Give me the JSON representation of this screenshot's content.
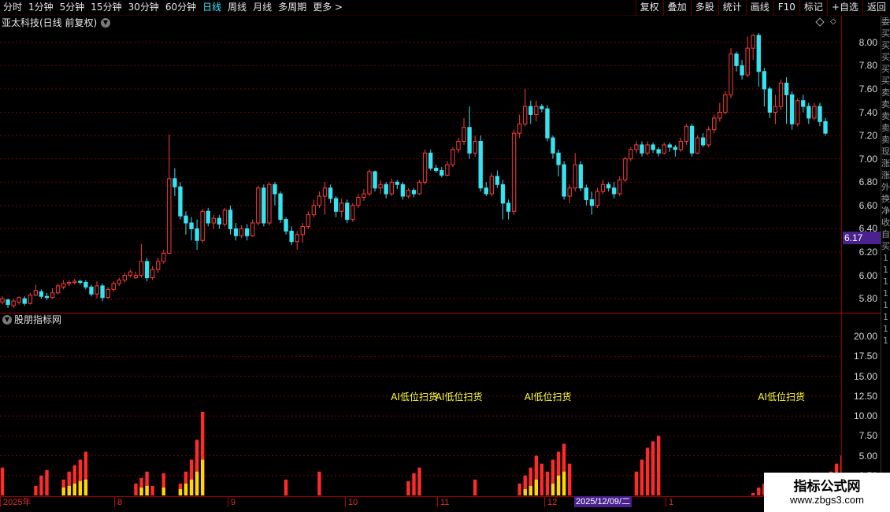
{
  "toolbar": {
    "periods": [
      "分时",
      "1分钟",
      "5分钟",
      "15分钟",
      "30分钟",
      "60分钟",
      "日线",
      "周线",
      "月线",
      "多周期",
      "更多 >"
    ],
    "active_period": "日线",
    "tools": [
      "复权",
      "叠加",
      "多股",
      "统计",
      "画线",
      "F10",
      "标记",
      "+自选",
      "返回"
    ]
  },
  "stock": {
    "title": "亚太科技(日线 前复权)",
    "last_price_label": "6.17"
  },
  "indicator": {
    "title": "股朋指标网",
    "signal_label": "AI低位扫货"
  },
  "side_chars": [
    "委",
    "买",
    "买",
    "买",
    "买",
    "买",
    "卖",
    "卖",
    "卖",
    "卖",
    "卖",
    "现",
    "涨",
    "涨",
    "外",
    "换",
    "净",
    "收",
    "自",
    "买",
    "1",
    "1",
    "1",
    "1",
    "1",
    "1",
    "1",
    "1"
  ],
  "time_axis": {
    "labels": [
      "2025年",
      "8",
      "9",
      "10",
      "11",
      "12",
      "1"
    ],
    "cursor_date": "2025/12/09/二"
  },
  "watermark": {
    "title": "指标公式网",
    "url": "www.zbgs3.com"
  },
  "colors": {
    "up": "#ff3c3c",
    "down": "#36e3f0",
    "grid": "#7a0000",
    "signal": "#ffff33",
    "vol_red": "#ff2a2a",
    "vol_yellow": "#ffd700"
  },
  "chart_data": {
    "type": "candlestick",
    "price_axis": {
      "ticks": [
        "8.00",
        "7.80",
        "7.60",
        "7.40",
        "7.20",
        "7.00",
        "6.80",
        "6.60",
        "6.40",
        "6.20",
        "6.00",
        "5.80"
      ],
      "ylim": [
        5.7,
        8.12
      ]
    },
    "indicator_axis": {
      "ticks": [
        "20.00",
        "17.50",
        "15.00",
        "12.50",
        "10.00",
        "7.50",
        "5.00",
        "2.50"
      ],
      "ylim": [
        0,
        21.5
      ]
    },
    "candles": [
      [
        5.77,
        5.8,
        5.82,
        5.75
      ],
      [
        5.79,
        5.75,
        5.8,
        5.72
      ],
      [
        5.74,
        5.78,
        5.8,
        5.72
      ],
      [
        5.77,
        5.81,
        5.82,
        5.75
      ],
      [
        5.8,
        5.76,
        5.82,
        5.74
      ],
      [
        5.76,
        5.83,
        5.85,
        5.75
      ],
      [
        5.83,
        5.87,
        5.92,
        5.82
      ],
      [
        5.86,
        5.82,
        5.88,
        5.8
      ],
      [
        5.82,
        5.81,
        5.85,
        5.79
      ],
      [
        5.81,
        5.85,
        5.89,
        5.8
      ],
      [
        5.85,
        5.91,
        5.93,
        5.84
      ],
      [
        5.9,
        5.93,
        5.96,
        5.88
      ],
      [
        5.93,
        5.94,
        5.96,
        5.91
      ],
      [
        5.94,
        5.95,
        5.97,
        5.92
      ],
      [
        5.95,
        5.94,
        5.96,
        5.92
      ],
      [
        5.94,
        5.9,
        5.96,
        5.88
      ],
      [
        5.9,
        5.84,
        5.92,
        5.82
      ],
      [
        5.84,
        5.91,
        5.95,
        5.8
      ],
      [
        5.91,
        5.81,
        5.93,
        5.78
      ],
      [
        5.81,
        5.88,
        5.9,
        5.8
      ],
      [
        5.88,
        5.93,
        5.95,
        5.86
      ],
      [
        5.93,
        5.96,
        5.98,
        5.91
      ],
      [
        5.96,
        6.0,
        6.02,
        5.94
      ],
      [
        6.0,
        6.03,
        6.05,
        5.98
      ],
      [
        5.98,
        6.0,
        6.03,
        5.97
      ],
      [
        6.0,
        6.12,
        6.27,
        5.98
      ],
      [
        6.12,
        5.98,
        6.15,
        5.95
      ],
      [
        5.98,
        6.05,
        6.08,
        5.96
      ],
      [
        6.05,
        6.12,
        6.15,
        6.02
      ],
      [
        6.12,
        6.19,
        6.22,
        6.1
      ],
      [
        6.19,
        6.83,
        7.21,
        6.18
      ],
      [
        6.83,
        6.76,
        6.92,
        6.68
      ],
      [
        6.76,
        6.51,
        6.8,
        6.48
      ],
      [
        6.51,
        6.45,
        6.55,
        6.35
      ],
      [
        6.45,
        6.4,
        6.5,
        6.3
      ],
      [
        6.4,
        6.3,
        6.48,
        6.22
      ],
      [
        6.3,
        6.55,
        6.57,
        6.28
      ],
      [
        6.55,
        6.45,
        6.58,
        6.42
      ],
      [
        6.45,
        6.49,
        6.52,
        6.4
      ],
      [
        6.49,
        6.44,
        6.52,
        6.4
      ],
      [
        6.44,
        6.56,
        6.58,
        6.42
      ],
      [
        6.56,
        6.4,
        6.6,
        6.35
      ],
      [
        6.4,
        6.34,
        6.45,
        6.3
      ],
      [
        6.34,
        6.4,
        6.43,
        6.32
      ],
      [
        6.4,
        6.34,
        6.44,
        6.3
      ],
      [
        6.34,
        6.45,
        6.48,
        6.33
      ],
      [
        6.45,
        6.75,
        6.77,
        6.43
      ],
      [
        6.75,
        6.45,
        6.78,
        6.42
      ],
      [
        6.45,
        6.78,
        6.8,
        6.43
      ],
      [
        6.78,
        6.7,
        6.8,
        6.6
      ],
      [
        6.7,
        6.48,
        6.72,
        6.45
      ],
      [
        6.48,
        6.38,
        6.5,
        6.35
      ],
      [
        6.38,
        6.29,
        6.42,
        6.26
      ],
      [
        6.29,
        6.35,
        6.38,
        6.22
      ],
      [
        6.35,
        6.42,
        6.45,
        6.28
      ],
      [
        6.42,
        6.52,
        6.55,
        6.4
      ],
      [
        6.52,
        6.6,
        6.65,
        6.5
      ],
      [
        6.6,
        6.68,
        6.72,
        6.58
      ],
      [
        6.68,
        6.75,
        6.8,
        6.52
      ],
      [
        6.75,
        6.66,
        6.78,
        6.62
      ],
      [
        6.66,
        6.55,
        6.68,
        6.5
      ],
      [
        6.55,
        6.62,
        6.66,
        6.5
      ],
      [
        6.62,
        6.48,
        6.65,
        6.45
      ],
      [
        6.48,
        6.6,
        6.62,
        6.46
      ],
      [
        6.6,
        6.67,
        6.7,
        6.58
      ],
      [
        6.67,
        6.7,
        6.74,
        6.64
      ],
      [
        6.7,
        6.89,
        6.91,
        6.68
      ],
      [
        6.89,
        6.75,
        6.9,
        6.72
      ],
      [
        6.75,
        6.78,
        6.82,
        6.7
      ],
      [
        6.78,
        6.7,
        6.8,
        6.66
      ],
      [
        6.7,
        6.8,
        6.83,
        6.68
      ],
      [
        6.8,
        6.78,
        6.82,
        6.74
      ],
      [
        6.78,
        6.68,
        6.8,
        6.65
      ],
      [
        6.68,
        6.73,
        6.75,
        6.66
      ],
      [
        6.73,
        6.7,
        6.75,
        6.67
      ],
      [
        6.7,
        6.8,
        6.82,
        6.69
      ],
      [
        6.8,
        7.05,
        7.08,
        6.78
      ],
      [
        7.05,
        6.92,
        7.08,
        6.9
      ],
      [
        6.92,
        6.9,
        6.95,
        6.88
      ],
      [
        6.9,
        6.86,
        6.93,
        6.84
      ],
      [
        6.86,
        6.95,
        6.98,
        6.85
      ],
      [
        6.95,
        7.08,
        7.1,
        6.93
      ],
      [
        7.08,
        7.15,
        7.18,
        7.05
      ],
      [
        7.15,
        7.27,
        7.35,
        7.12
      ],
      [
        7.27,
        7.05,
        7.45,
        7.0
      ],
      [
        7.05,
        7.15,
        7.2,
        7.02
      ],
      [
        7.15,
        6.75,
        7.2,
        6.72
      ],
      [
        6.75,
        6.7,
        6.8,
        6.68
      ],
      [
        6.7,
        6.85,
        6.88,
        6.68
      ],
      [
        6.85,
        6.78,
        6.9,
        6.75
      ],
      [
        6.78,
        6.62,
        6.82,
        6.48
      ],
      [
        6.62,
        6.55,
        6.65,
        6.48
      ],
      [
        6.55,
        7.22,
        7.25,
        6.52
      ],
      [
        7.22,
        7.3,
        7.38,
        7.18
      ],
      [
        7.3,
        7.45,
        7.6,
        7.28
      ],
      [
        7.45,
        7.38,
        7.5,
        7.3
      ],
      [
        7.38,
        7.45,
        7.5,
        7.32
      ],
      [
        7.45,
        7.43,
        7.47,
        7.4
      ],
      [
        7.43,
        7.18,
        7.46,
        7.15
      ],
      [
        7.18,
        7.05,
        7.2,
        7.0
      ],
      [
        7.05,
        6.95,
        7.08,
        6.85
      ],
      [
        6.95,
        6.68,
        6.98,
        6.65
      ],
      [
        6.68,
        6.75,
        6.78,
        6.62
      ],
      [
        6.75,
        6.95,
        7.05,
        6.72
      ],
      [
        6.95,
        6.75,
        6.98,
        6.72
      ],
      [
        6.75,
        6.65,
        6.78,
        6.6
      ],
      [
        6.65,
        6.6,
        6.72,
        6.52
      ],
      [
        6.6,
        6.72,
        6.75,
        6.58
      ],
      [
        6.72,
        6.78,
        6.82,
        6.7
      ],
      [
        6.78,
        6.75,
        6.8,
        6.72
      ],
      [
        6.75,
        6.7,
        6.8,
        6.66
      ],
      [
        6.7,
        6.82,
        6.85,
        6.68
      ],
      [
        6.82,
        7.0,
        7.02,
        6.8
      ],
      [
        7.0,
        7.08,
        7.1,
        6.98
      ],
      [
        7.08,
        7.12,
        7.15,
        7.05
      ],
      [
        7.12,
        7.05,
        7.15,
        7.02
      ],
      [
        7.05,
        7.12,
        7.15,
        7.03
      ],
      [
        7.12,
        7.08,
        7.14,
        7.05
      ],
      [
        7.08,
        7.05,
        7.1,
        7.02
      ],
      [
        7.05,
        7.12,
        7.14,
        7.04
      ],
      [
        7.12,
        7.1,
        7.14,
        7.06
      ],
      [
        7.1,
        7.08,
        7.12,
        7.02
      ],
      [
        7.08,
        7.15,
        7.18,
        7.06
      ],
      [
        7.15,
        7.28,
        7.3,
        7.12
      ],
      [
        7.28,
        7.05,
        7.3,
        7.02
      ],
      [
        7.05,
        7.18,
        7.2,
        7.04
      ],
      [
        7.18,
        7.12,
        7.22,
        7.1
      ],
      [
        7.12,
        7.25,
        7.28,
        7.1
      ],
      [
        7.25,
        7.35,
        7.38,
        7.22
      ],
      [
        7.35,
        7.4,
        7.48,
        7.32
      ],
      [
        7.4,
        7.55,
        7.58,
        7.38
      ],
      [
        7.55,
        7.9,
        7.95,
        7.52
      ],
      [
        7.9,
        7.8,
        7.92,
        7.75
      ],
      [
        7.8,
        7.72,
        7.85,
        7.68
      ],
      [
        7.72,
        7.95,
        8.05,
        7.7
      ],
      [
        7.95,
        8.06,
        8.07,
        7.85
      ],
      [
        8.06,
        7.75,
        8.08,
        7.62
      ],
      [
        7.75,
        7.6,
        7.78,
        7.45
      ],
      [
        7.6,
        7.4,
        7.62,
        7.35
      ],
      [
        7.4,
        7.45,
        7.55,
        7.3
      ],
      [
        7.45,
        7.65,
        7.68,
        7.42
      ],
      [
        7.65,
        7.55,
        7.7,
        7.3
      ],
      [
        7.55,
        7.3,
        7.58,
        7.25
      ],
      [
        7.3,
        7.5,
        7.52,
        7.28
      ],
      [
        7.5,
        7.45,
        7.55,
        7.4
      ],
      [
        7.45,
        7.35,
        7.48,
        7.3
      ],
      [
        7.35,
        7.45,
        7.48,
        7.33
      ],
      [
        7.45,
        7.32,
        7.48,
        7.28
      ],
      [
        7.32,
        7.22,
        7.35,
        7.2
      ]
    ],
    "volume_bars": [
      [
        3.5,
        0
      ],
      [
        0,
        0
      ],
      [
        0,
        0
      ],
      [
        0,
        0
      ],
      [
        0,
        0
      ],
      [
        0,
        0
      ],
      [
        1.2,
        0
      ],
      [
        2.5,
        0
      ],
      [
        3.2,
        0
      ],
      [
        0,
        0
      ],
      [
        0,
        0
      ],
      [
        2.0,
        1.0
      ],
      [
        3.0,
        1.2
      ],
      [
        3.8,
        1.5
      ],
      [
        4.5,
        1.8
      ],
      [
        5.5,
        2.0
      ],
      [
        0,
        0
      ],
      [
        0,
        0
      ],
      [
        0,
        0
      ],
      [
        0,
        0
      ],
      [
        0,
        0
      ],
      [
        0,
        0
      ],
      [
        0,
        0
      ],
      [
        0,
        0
      ],
      [
        1.5,
        0
      ],
      [
        2.2,
        1.0
      ],
      [
        3.0,
        1.2
      ],
      [
        1.2,
        0
      ],
      [
        0,
        0
      ],
      [
        2.8,
        1.0
      ],
      [
        0,
        0
      ],
      [
        0,
        0
      ],
      [
        1.5,
        0.8
      ],
      [
        3.0,
        1.5
      ],
      [
        4.5,
        2.0
      ],
      [
        7.0,
        3.0
      ],
      [
        10.5,
        4.5
      ],
      [
        0,
        0
      ],
      [
        0,
        0
      ],
      [
        0,
        0
      ],
      [
        0,
        0
      ],
      [
        0,
        0
      ],
      [
        0,
        0
      ],
      [
        0,
        0
      ],
      [
        0,
        0
      ],
      [
        0,
        0
      ],
      [
        0,
        0
      ],
      [
        0,
        0
      ],
      [
        0,
        0
      ],
      [
        0,
        0
      ],
      [
        0,
        0
      ],
      [
        2.0,
        0
      ],
      [
        0,
        0
      ],
      [
        0,
        0
      ],
      [
        0,
        0
      ],
      [
        0,
        0
      ],
      [
        0,
        0
      ],
      [
        3.0,
        0
      ],
      [
        0,
        0
      ],
      [
        0,
        0
      ],
      [
        0,
        0
      ],
      [
        0,
        0
      ],
      [
        0,
        0
      ],
      [
        0,
        0
      ],
      [
        0,
        0
      ],
      [
        0,
        0
      ],
      [
        0,
        0
      ],
      [
        0,
        0
      ],
      [
        0,
        0
      ],
      [
        0,
        0
      ],
      [
        0,
        0
      ],
      [
        0,
        0
      ],
      [
        0,
        0
      ],
      [
        1.8,
        0
      ],
      [
        2.8,
        0
      ],
      [
        3.5,
        0
      ],
      [
        0,
        0
      ],
      [
        0,
        0
      ],
      [
        0,
        0
      ],
      [
        0,
        0
      ],
      [
        0,
        0
      ],
      [
        0,
        0
      ],
      [
        0,
        0
      ],
      [
        0,
        0
      ],
      [
        0,
        0
      ],
      [
        2.0,
        0
      ],
      [
        0,
        0
      ],
      [
        0,
        0
      ],
      [
        0,
        0
      ],
      [
        0,
        0
      ],
      [
        0,
        0
      ],
      [
        0,
        0
      ],
      [
        0,
        0
      ],
      [
        1.5,
        0
      ],
      [
        2.5,
        0.8
      ],
      [
        3.5,
        1.2
      ],
      [
        5.0,
        2.0
      ],
      [
        4.0,
        0
      ],
      [
        3.0,
        0
      ],
      [
        4.5,
        1.5
      ],
      [
        5.5,
        2.5
      ],
      [
        6.5,
        3.0
      ],
      [
        4.0,
        0
      ],
      [
        0,
        0
      ],
      [
        0,
        0
      ],
      [
        0,
        0
      ],
      [
        0,
        0
      ],
      [
        0,
        0
      ],
      [
        0,
        0
      ],
      [
        0,
        0
      ],
      [
        0,
        0
      ],
      [
        0,
        0
      ],
      [
        0,
        0
      ],
      [
        0,
        0
      ],
      [
        3.0,
        0
      ],
      [
        4.5,
        0
      ],
      [
        6.0,
        0
      ],
      [
        6.8,
        0
      ],
      [
        7.5,
        0
      ],
      [
        0,
        0
      ],
      [
        0,
        0
      ],
      [
        0,
        0
      ],
      [
        0,
        0
      ],
      [
        0,
        0
      ],
      [
        0,
        0
      ],
      [
        0,
        0
      ],
      [
        0,
        0
      ],
      [
        0,
        0
      ],
      [
        0,
        0
      ],
      [
        0,
        0
      ],
      [
        0,
        0
      ],
      [
        0,
        0
      ],
      [
        0,
        0
      ],
      [
        0,
        0
      ],
      [
        0,
        0
      ],
      [
        0.3,
        0
      ],
      [
        1.0,
        0
      ],
      [
        1.5,
        0
      ],
      [
        2.0,
        0
      ],
      [
        2.5,
        0
      ],
      [
        0,
        0
      ],
      [
        0,
        0
      ],
      [
        0,
        0
      ],
      [
        0,
        0
      ],
      [
        0,
        0
      ],
      [
        0,
        0
      ],
      [
        0,
        0
      ],
      [
        1.5,
        0
      ],
      [
        2.0,
        0
      ],
      [
        3.0,
        0
      ],
      [
        4.0,
        0
      ],
      [
        5.0,
        0
      ],
      [
        6.0,
        2.5
      ],
      [
        7.0,
        3.5
      ],
      [
        8.5,
        4.0
      ],
      [
        9.5,
        4.5
      ],
      [
        10.0,
        5.0
      ],
      [
        0,
        0
      ],
      [
        8.0,
        3.8
      ]
    ],
    "signals": [
      [
        "AI低位扫货",
        70.0,
        12.5
      ],
      [
        "AI低位扫货",
        78.0,
        12.5
      ],
      [
        "AI低位扫货",
        94.0,
        12.5
      ],
      [
        "AI低位扫货",
        136.0,
        12.5
      ]
    ]
  }
}
